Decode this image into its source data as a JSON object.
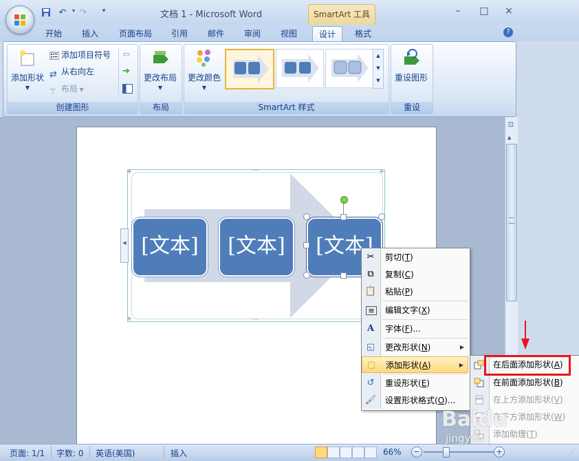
{
  "title_bar": {
    "document_title": "文档 1 - Microsoft Word",
    "context_tools": "SmartArt 工具",
    "quick_access": [
      "save-icon",
      "undo-icon",
      "redo-icon",
      "customize-icon"
    ]
  },
  "window_controls": {
    "minimize": "–",
    "maximize": "□",
    "close": "×"
  },
  "tabs": [
    {
      "label": "开始"
    },
    {
      "label": "插入"
    },
    {
      "label": "页面布局"
    },
    {
      "label": "引用"
    },
    {
      "label": "邮件"
    },
    {
      "label": "审阅"
    },
    {
      "label": "视图"
    },
    {
      "label": "设计",
      "active": true
    },
    {
      "label": "格式"
    }
  ],
  "help": "?",
  "ribbon": {
    "create_group": {
      "label": "创建图形",
      "add_shape": "添加形状",
      "add_bullet": "添加项目符号",
      "right_to_left": "从右向左",
      "layout": "布局"
    },
    "layout_group": {
      "label": "布局",
      "change_layout": "更改布局"
    },
    "styles_group": {
      "label": "SmartArt 样式",
      "change_colors": "更改颜色"
    },
    "reset_group": {
      "label": "重设",
      "reset_graphic": "重设图形"
    }
  },
  "smartart": {
    "boxes": [
      "[文本]",
      "[文本]",
      "[文本]"
    ],
    "box_color": "#4f7dba",
    "arrow_color": "#d2d9e6"
  },
  "context_menu": {
    "items": [
      {
        "label": "剪切(",
        "key": "T",
        "end": ")",
        "icon": "scissors-icon"
      },
      {
        "label": "复制(",
        "key": "C",
        "end": ")",
        "icon": "copy-icon"
      },
      {
        "label": "粘贴(",
        "key": "P",
        "end": ")",
        "icon": "paste-icon"
      },
      {
        "label": "编辑文字(",
        "key": "X",
        "end": ")",
        "icon": "edit-text-icon"
      },
      {
        "label": "字体(",
        "key": "F",
        "end": ")...",
        "icon": "font-icon"
      },
      {
        "label": "更改形状(",
        "key": "N",
        "end": ")",
        "icon": "change-shape-icon"
      },
      {
        "label": "添加形状(",
        "key": "A",
        "end": ")",
        "icon": "add-shape-icon"
      },
      {
        "label": "重设形状(",
        "key": "E",
        "end": ")",
        "icon": "reset-shape-icon"
      },
      {
        "label": "设置形状格式(",
        "key": "O",
        "end": ")...",
        "icon": "format-shape-icon"
      }
    ]
  },
  "submenu": {
    "items": [
      {
        "label": "在后面添加形状(",
        "key": "A",
        "end": ")"
      },
      {
        "label": "在前面添加形状(",
        "key": "B",
        "end": ")"
      },
      {
        "label": "在上方添加形状(",
        "key": "V",
        "end": ")"
      },
      {
        "label": "在下方添加形状(",
        "key": "W",
        "end": ")"
      },
      {
        "label": "添加助理(",
        "key": "T",
        "end": ")"
      }
    ]
  },
  "status_bar": {
    "page": "页面: 1/1",
    "words": "字数: 0",
    "language": "英语(美国)",
    "mode": "插入",
    "zoom": "66%",
    "zoom_value": 66
  },
  "watermark": {
    "line1": "Baidu",
    "line2": "jingyan"
  },
  "colors": {
    "highlight_box": "#e8151a",
    "menu_hover": "#ffd87a"
  }
}
